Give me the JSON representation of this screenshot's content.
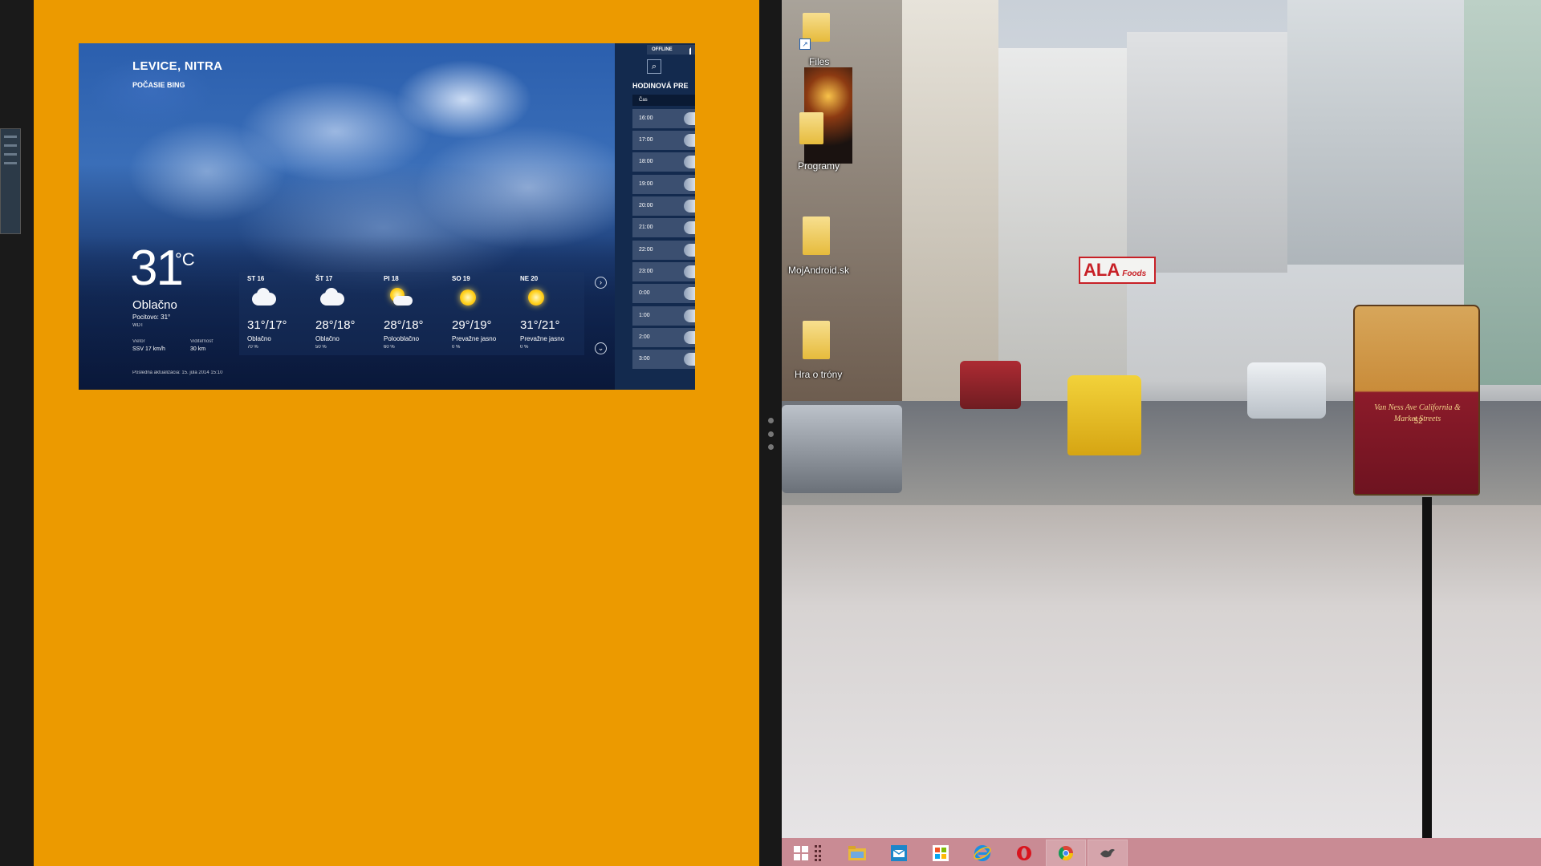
{
  "weather": {
    "location": "LEVICE, NITRA",
    "source": "POČASIE BING",
    "temperature": "31",
    "unit": "°C",
    "condition": "Oblačno",
    "feels_like": "Pocitovo: 31°",
    "station": "WDT",
    "wind_label": "Vietor",
    "wind_value": "SSV 17 km/h",
    "visibility_label": "Viditeľnosť",
    "visibility_value": "30 km",
    "updated": "Posledná aktualizácia: 15. júla 2014 15:10",
    "forecast": [
      {
        "day": "ST 16",
        "temps": "31°/17°",
        "desc": "Oblačno",
        "rain": "70 %"
      },
      {
        "day": "ŠT 17",
        "temps": "28°/18°",
        "desc": "Oblačno",
        "rain": "50 %"
      },
      {
        "day": "PI 18",
        "temps": "28°/18°",
        "desc": "Polooblačno",
        "rain": "60 %"
      },
      {
        "day": "SO 19",
        "temps": "29°/19°",
        "desc": "Prevažne jasno",
        "rain": "0 %"
      },
      {
        "day": "NE 20",
        "temps": "31°/21°",
        "desc": "Prevažne jasno",
        "rain": "0 %"
      }
    ],
    "next_icon": "arrow-right-circle-icon",
    "down_icon": "arrow-down-circle-icon",
    "hourly": {
      "status": "OFFLINE",
      "title": "HODINOVÁ PRE",
      "column": "Čas",
      "hours": [
        "16:00",
        "17:00",
        "18:00",
        "19:00",
        "20:00",
        "21:00",
        "22:00",
        "23:00",
        "0:00",
        "1:00",
        "2:00",
        "3:00"
      ]
    }
  },
  "desktop": {
    "icons": [
      {
        "label": "Files",
        "icon": "folder-icon"
      },
      {
        "label": "Programy",
        "icon": "folder-icon"
      },
      {
        "label": "MojAndroid.sk",
        "icon": "folder-icon"
      },
      {
        "label": "Hra o tróny",
        "icon": "folder-icon"
      }
    ],
    "billboard": "ALA",
    "billboard_sub": "Foods",
    "tram_text": "Van Ness Ave California & Market Streets",
    "tram_number": "52"
  },
  "taskbar": {
    "color": "#c98b94",
    "items": [
      "windows-start-icon",
      "apps-grip-icon",
      "file-explorer-icon",
      "outlook-icon",
      "windows-store-icon",
      "internet-explorer-icon",
      "opera-icon",
      "chrome-icon",
      "bird-app-icon"
    ]
  }
}
